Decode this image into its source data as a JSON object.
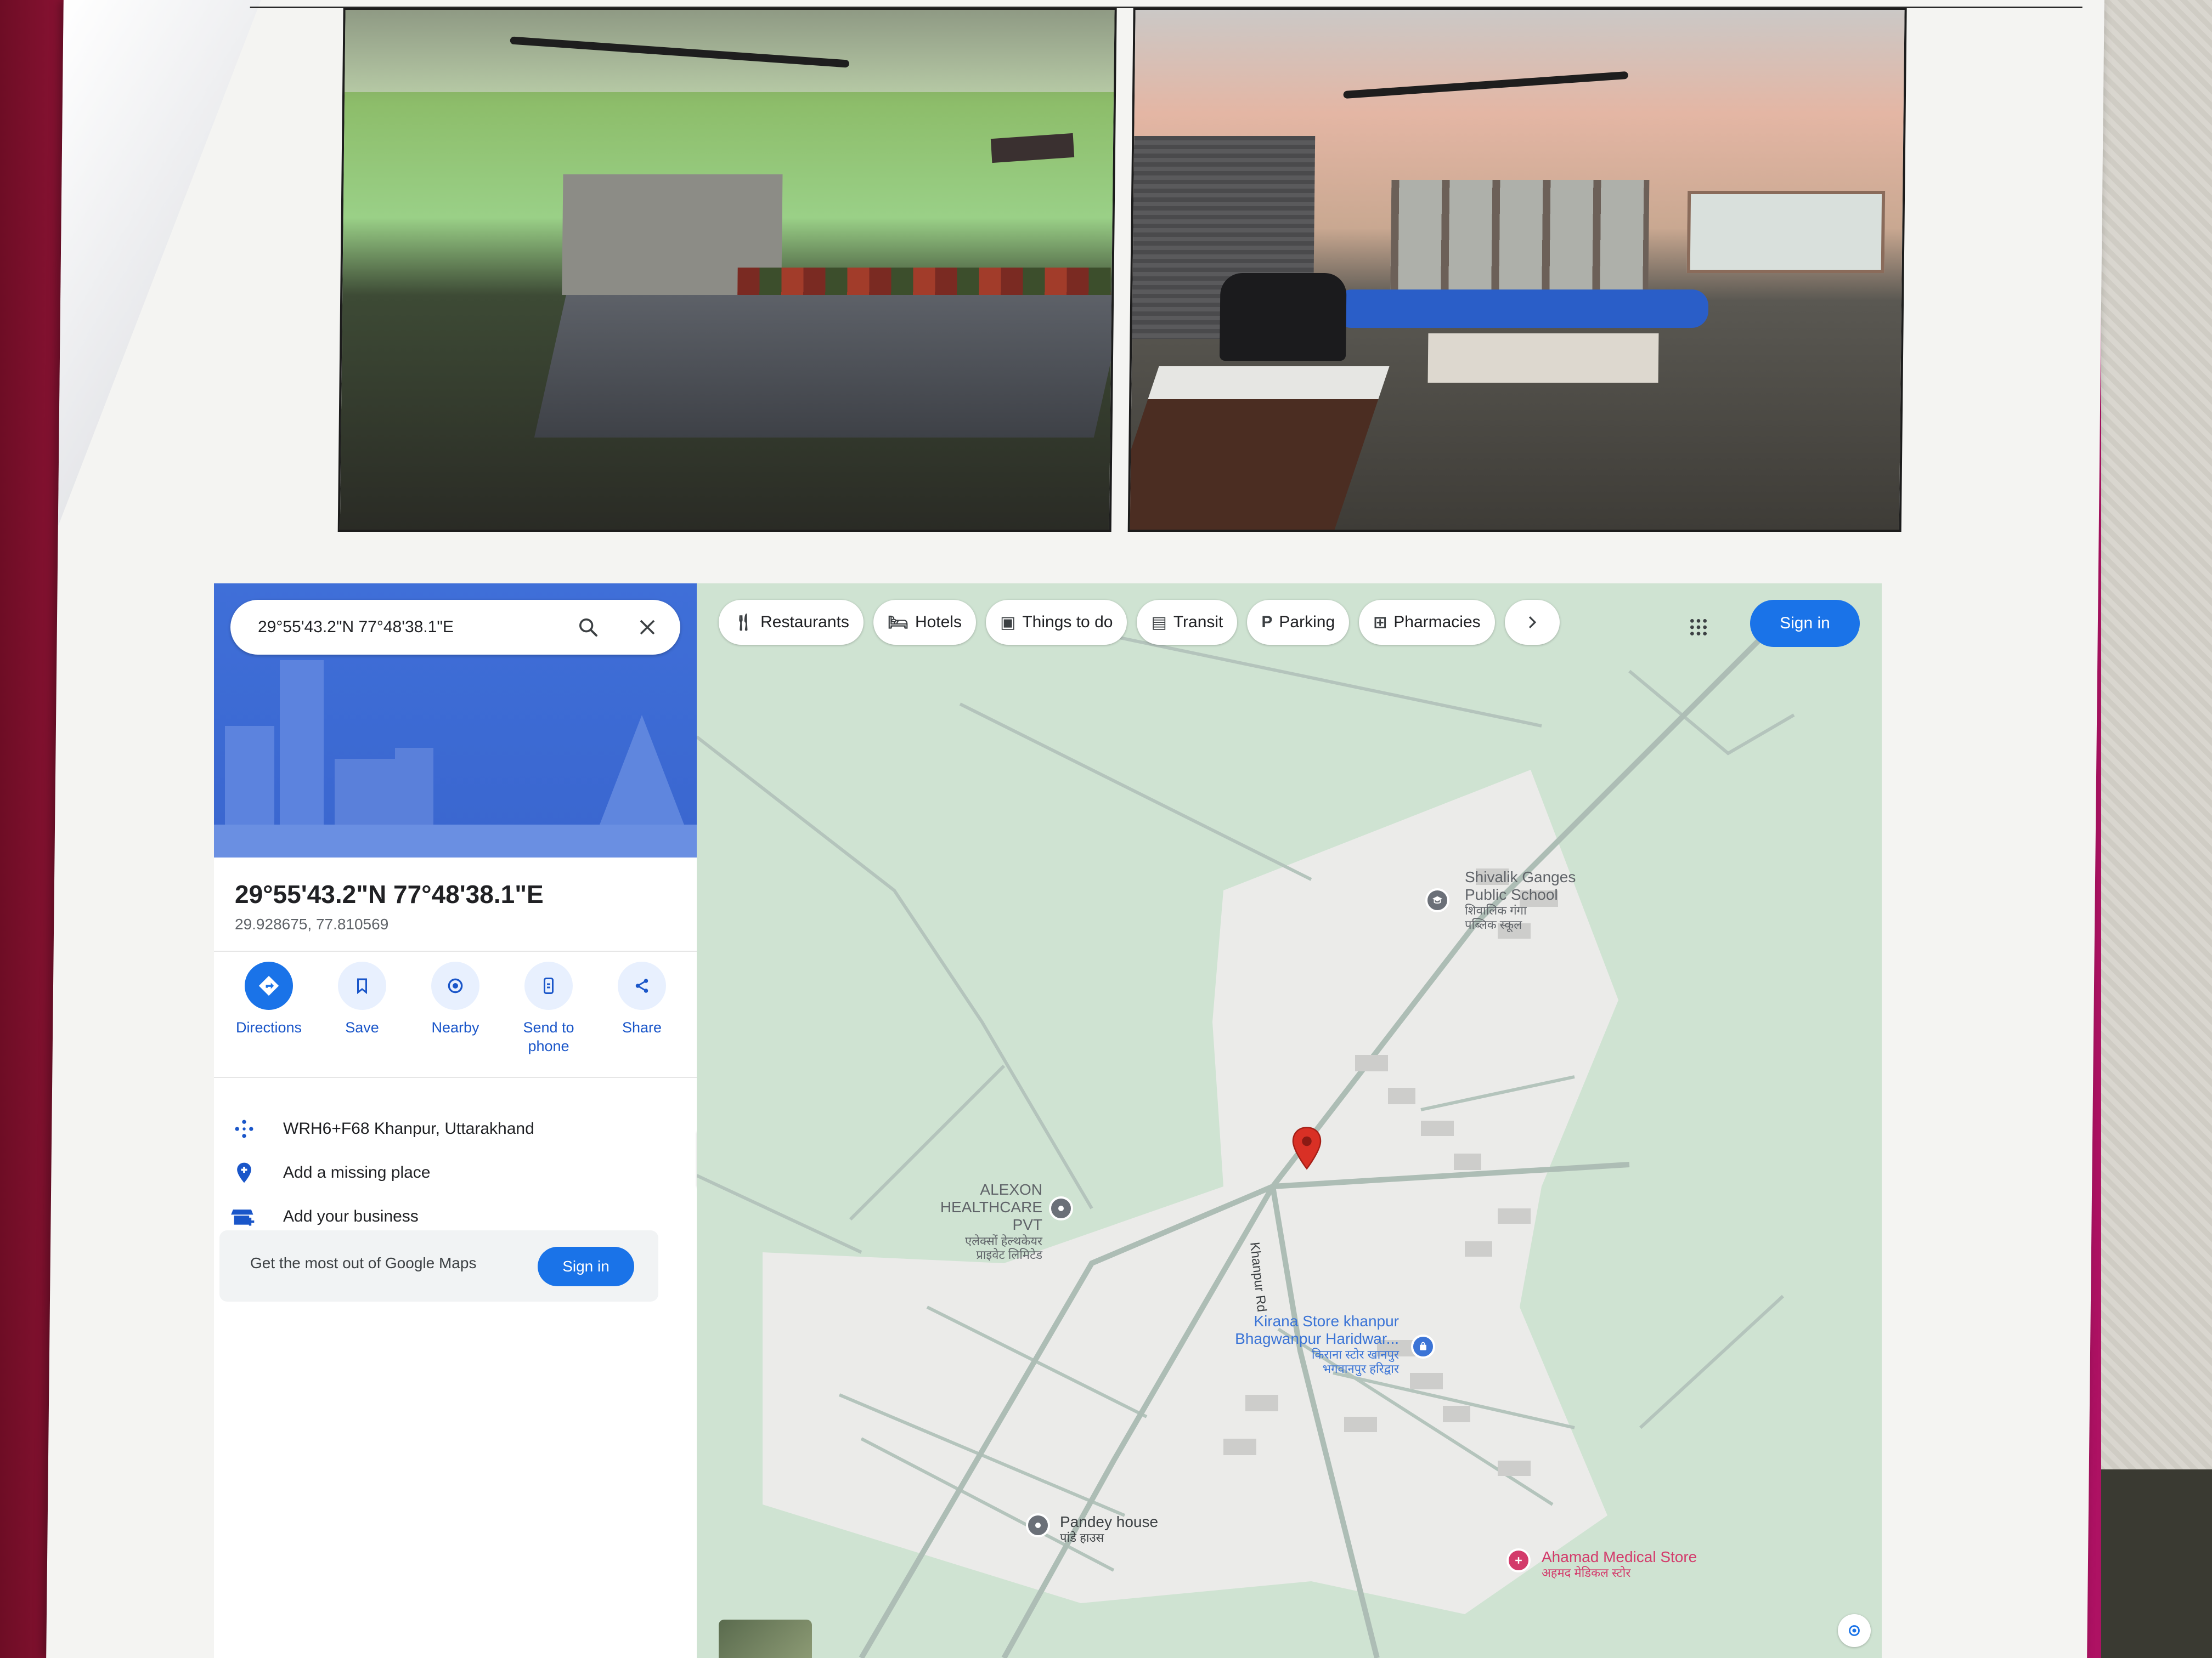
{
  "search": {
    "query": "29°55'43.2\"N 77°48'38.1\"E"
  },
  "place": {
    "title": "29°55'43.2\"N 77°48'38.1\"E",
    "decimal": "29.928675, 77.810569"
  },
  "actions": [
    {
      "label": "Directions",
      "icon": "directions-icon"
    },
    {
      "label": "Save",
      "icon": "bookmark-icon"
    },
    {
      "label": "Nearby",
      "icon": "nearby-icon"
    },
    {
      "label": "Send to phone",
      "icon": "phone-icon"
    },
    {
      "label": "Share",
      "icon": "share-icon"
    }
  ],
  "info": {
    "plus_code": "WRH6+F68 Khanpur, Uttarakhand",
    "add_place": "Add a missing place",
    "add_business": "Add your business"
  },
  "promo": {
    "text": "Get the most out of Google Maps",
    "button": "Sign in"
  },
  "chips": [
    {
      "label": "Restaurants",
      "icon": "fork-knife-icon"
    },
    {
      "label": "Hotels",
      "icon": "bed-icon"
    },
    {
      "label": "Things to do",
      "icon": "camera-icon"
    },
    {
      "label": "Transit",
      "icon": "bus-icon"
    },
    {
      "label": "Parking",
      "icon": "parking-icon"
    },
    {
      "label": "Pharmacies",
      "icon": "pharmacy-icon"
    }
  ],
  "header": {
    "signin": "Sign in"
  },
  "map": {
    "places": {
      "school": {
        "line1": "Shivalik Ganges",
        "line2": "Public School",
        "native1": "शिवालिक गंगा",
        "native2": "पब्लिक स्कूल"
      },
      "alexon": {
        "line1": "ALEXON",
        "line2": "HEALTHCARE PVT",
        "native1": "एलेक्सों हेल्थकेयर",
        "native2": "प्राइवेट लिमिटेड"
      },
      "kirana": {
        "line1": "Kirana Store khanpur",
        "line2": "Bhagwanpur Haridwar...",
        "native1": "किराना स्टोर खानपुर",
        "native2": "भगवानपुर हरिद्वार"
      },
      "pandey": {
        "line1": "Pandey house",
        "native1": "पांडे हाउस"
      },
      "ahamad": {
        "line1": "Ahamad Medical Store",
        "native1": "अहमद मेडिकल स्टोर"
      }
    },
    "road": "Khanpur Rd"
  },
  "colors": {
    "accent": "#1a73e8",
    "map_green": "#cfe3d2",
    "map_urban": "#ebebe9",
    "pin_red": "#d93025",
    "pharmacy_pink": "#d33b6b",
    "poi_gray": "#6b7078",
    "poi_blue": "#3b74d6"
  }
}
